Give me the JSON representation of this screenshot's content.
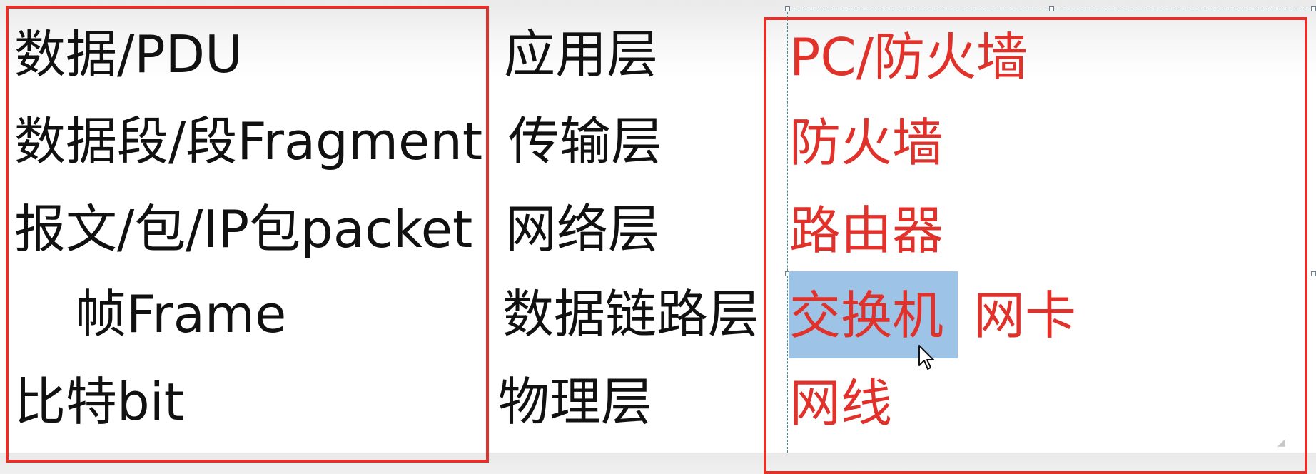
{
  "layers": [
    {
      "pdu": "数据/PDU",
      "layer": "应用层",
      "devices": [
        "PC/防火墙"
      ]
    },
    {
      "pdu": "数据段/段Fragment",
      "layer": "传输层",
      "devices": [
        "防火墙"
      ]
    },
    {
      "pdu": "报文/包/IP包packet",
      "layer": "网络层",
      "devices": [
        "路由器"
      ]
    },
    {
      "pdu": "帧Frame",
      "layer": "数据链路层",
      "devices": [
        "交换机",
        "网卡"
      ]
    },
    {
      "pdu": "比特bit",
      "layer": "物理层",
      "devices": [
        "网线"
      ]
    }
  ],
  "selection": {
    "selected_text": "交换机"
  },
  "icons": {
    "cursor": "arrow-cursor-icon",
    "scroll_hint": "scroll-indicator-icon"
  },
  "colors": {
    "border": "#e0312b",
    "device_text": "#e0312b",
    "text": "#111111",
    "selection_highlight": "#9dc3e6"
  }
}
